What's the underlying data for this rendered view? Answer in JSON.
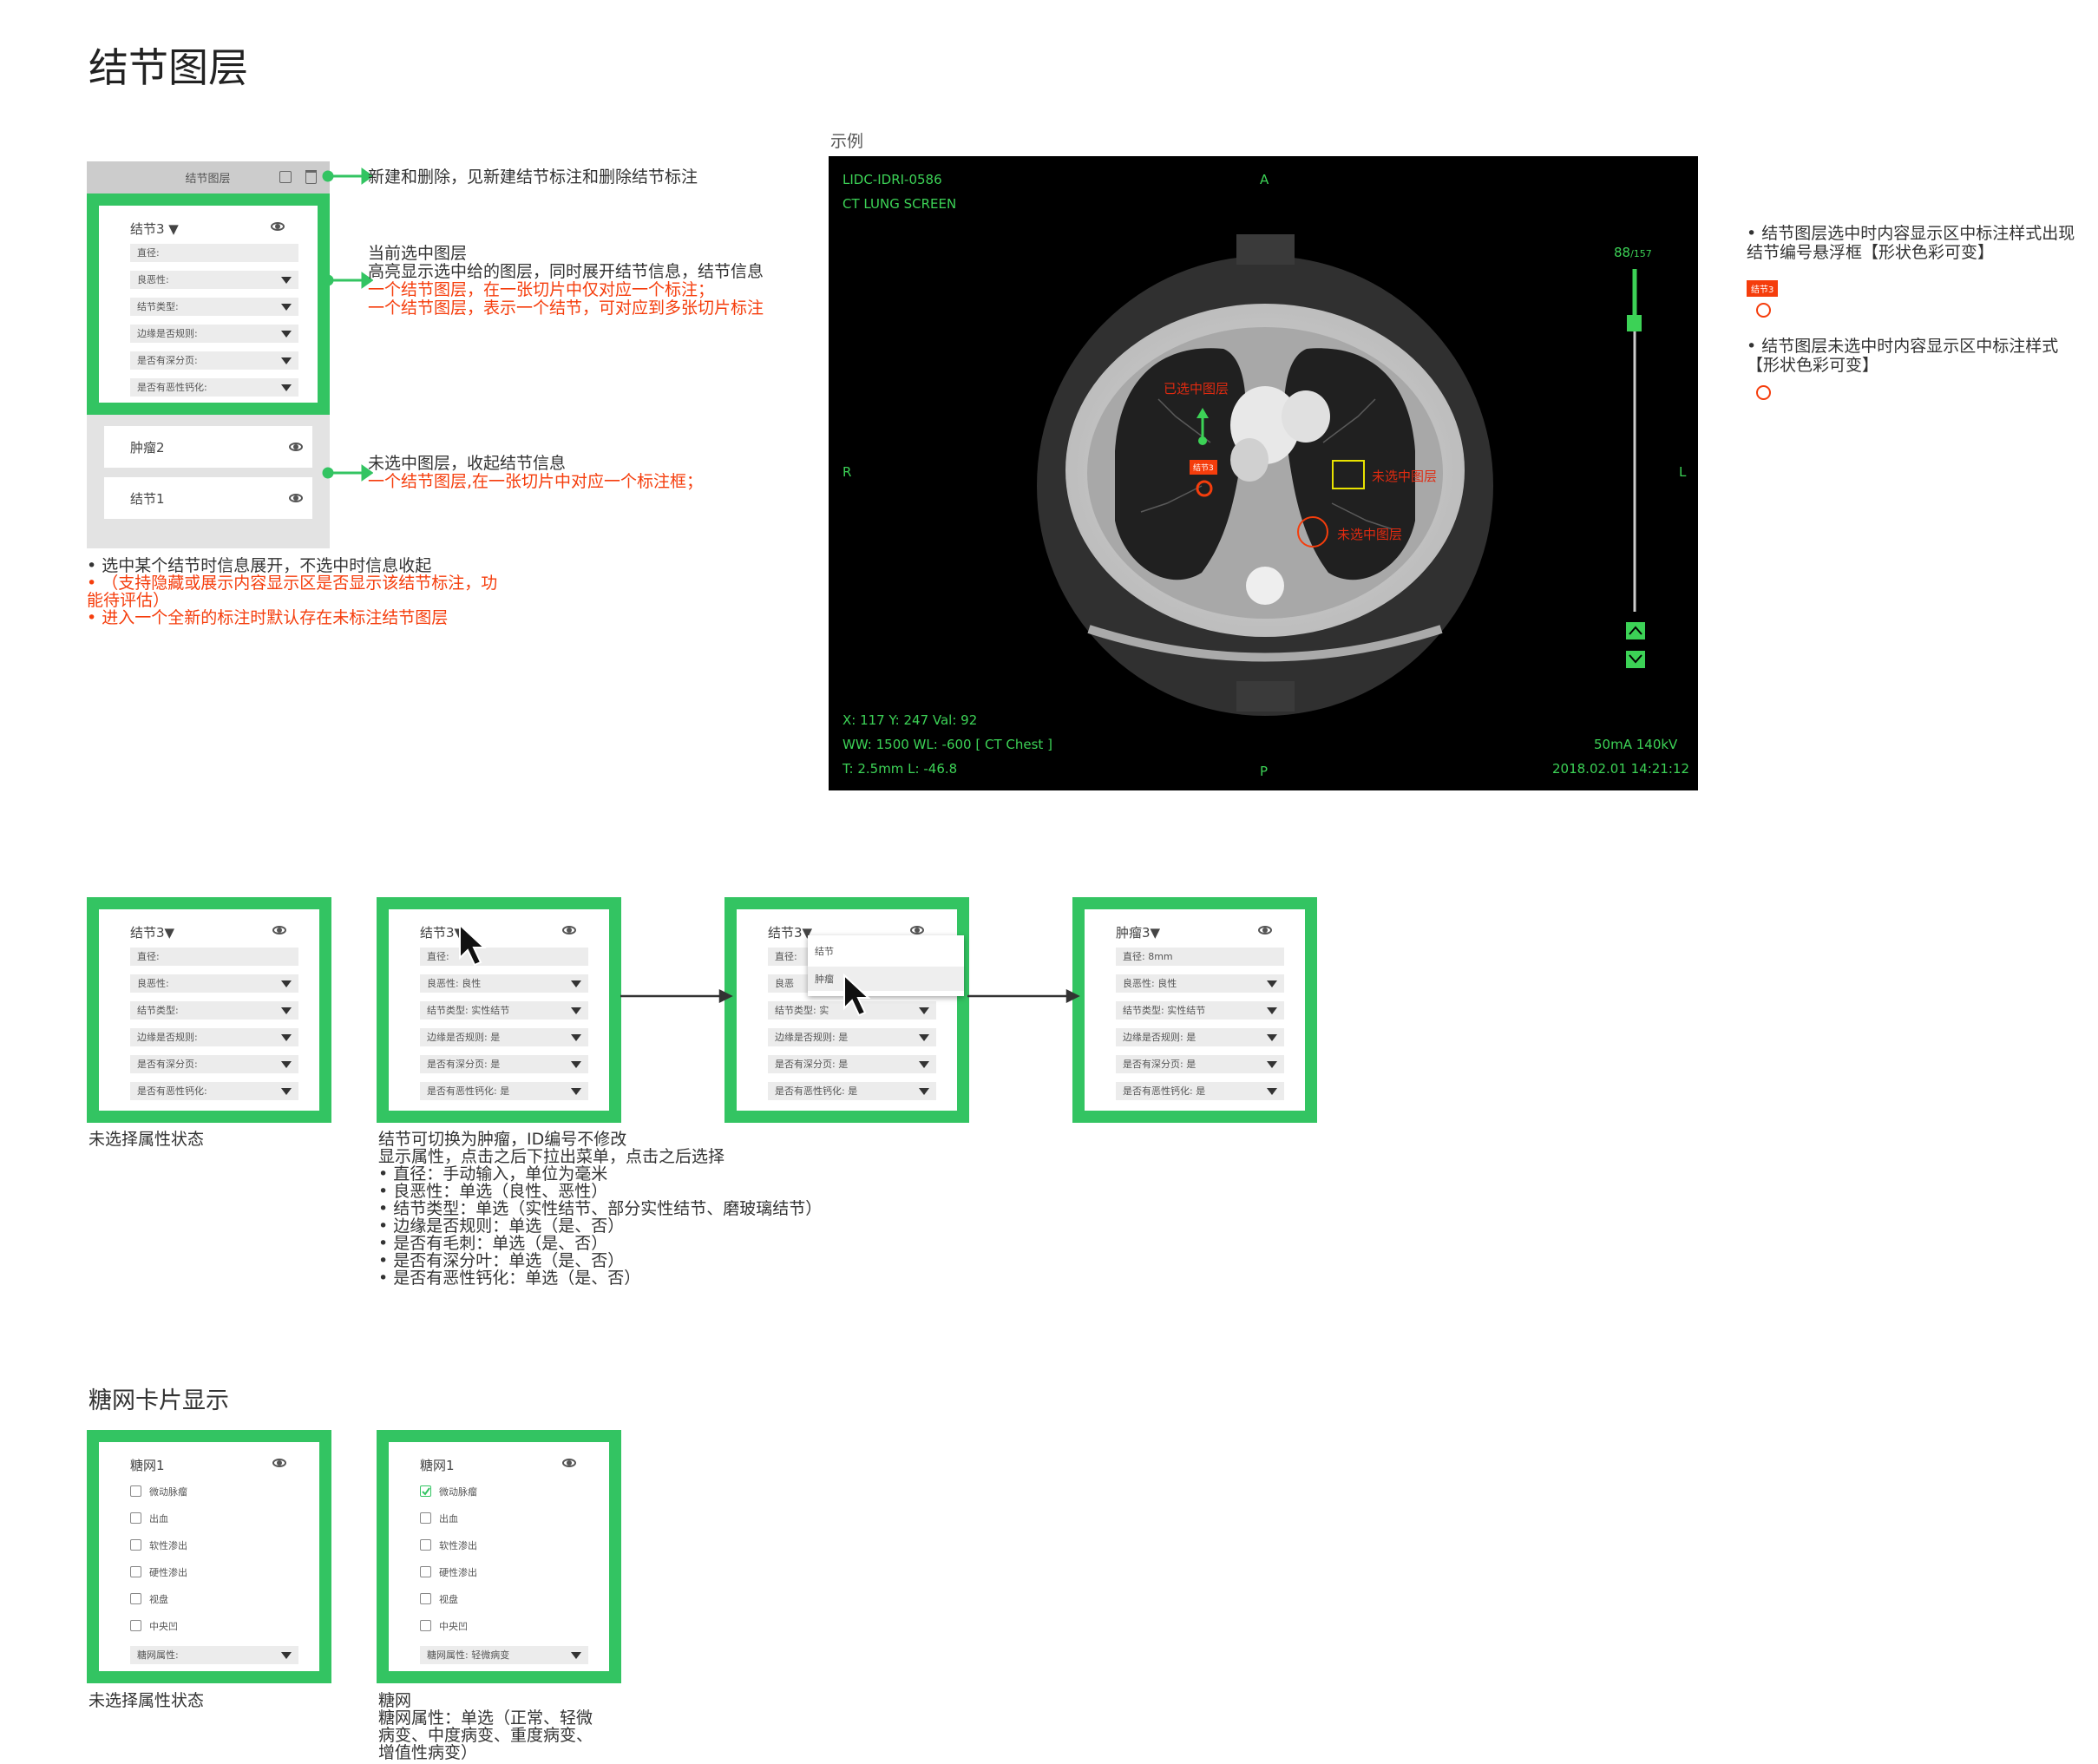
{
  "page_title": "结节图层",
  "example_label": "示例",
  "layer_panel": {
    "header": "结节图层",
    "selected": {
      "name": "结节3 ▼",
      "fields": [
        "直径:",
        "良恶性:",
        "结节类型:",
        "边缘是否规则:",
        "是否有深分页:",
        "是否有恶性钙化:"
      ]
    },
    "collapsed": [
      {
        "name": "肿瘤2"
      },
      {
        "name": "结节1"
      }
    ]
  },
  "annotations": {
    "a1": "新建和删除，见新建结节标注和删除结节标注",
    "a2_lines": [
      "当前选中图层",
      "高亮显示选中给的图层，同时展开结节信息，结节信息"
    ],
    "a2_red": [
      "一个结节图层，在一张切片中仅对应一个标注；",
      "一个结节图层，表示一个结节，可对应到多张切片标注"
    ],
    "a3": "未选中图层，收起结节信息",
    "a3_red": "一个结节图层,在一张切片中对应一个标注框；"
  },
  "notes1": {
    "l1": "• 选中某个结节时信息展开，不选中时信息收起",
    "l2": "• （支持隐藏或展示内容显示区是否显示该结节标注，功",
    "l3": "能待评估）",
    "l4": "• 进入一个全新的标注时默认存在未标注结节图层"
  },
  "ct": {
    "patient": "LIDC-IDRI-0586",
    "study": "CT   LUNG   SCREEN",
    "dir_a": "A",
    "dir_p": "P",
    "dir_r": "R",
    "dir_l": "L",
    "slice": "88",
    "slice_total": "/157",
    "coords": "X: 117    Y: 247    Val: 92",
    "window": "WW: 1500    WL: -600 [ CT Chest ]",
    "thick": "T: 2.5mm    L: -46.8",
    "tube": "50mA    140kV",
    "datetime": "2018.02.01    14:21:12",
    "lbl_selected": "已选中图层",
    "lbl_unselected1": "未选中图层",
    "lbl_unselected2": "未选中图层",
    "tag": "结节3"
  },
  "right_notes": {
    "n1a": "• 结节图层选中时内容显示区中标注样式出现",
    "n1b": "结节编号悬浮框【形状色彩可变】",
    "tag": "结节3",
    "n2a": "• 结节图层未选中时内容显示区中标注样式",
    "n2b": "【形状色彩可变】"
  },
  "flow": {
    "c1": {
      "name": "结节3▼",
      "fields": [
        "直径:",
        "良恶性:",
        "结节类型:",
        "边缘是否规则:",
        "是否有深分页:",
        "是否有恶性钙化:"
      ]
    },
    "c2": {
      "name": "结节3▼",
      "fields": [
        "直径:",
        "良恶性:  良性",
        "结节类型:  实性结节",
        "边缘是否规则:  是",
        "是否有深分页:  是",
        "是否有恶性钙化:  是"
      ]
    },
    "c3": {
      "name": "结节3▼",
      "fields": [
        "直径:",
        "良恶",
        "结节类型:  实",
        "边缘是否规则:  是",
        "是否有深分页:  是",
        "是否有恶性钙化:  是"
      ],
      "menu": [
        "结节",
        "肿瘤"
      ]
    },
    "c4": {
      "name": "肿瘤3▼",
      "fields": [
        "直径:  8mm",
        "良恶性:  良性",
        "结节类型:  实性结节",
        "边缘是否规则:  是",
        "是否有深分页:  是",
        "是否有恶性钙化:  是"
      ]
    },
    "cap1": "未选择属性状态",
    "cap2": [
      "结节可切换为肿瘤，ID编号不修改",
      "显示属性，点击之后下拉出菜单，点击之后选择",
      "• 直径：手动输入，单位为毫米",
      "• 良恶性：单选（良性、恶性）",
      "• 结节类型：单选（实性结节、部分实性结节、磨玻璃结节）",
      "• 边缘是否规则：单选（是、否）",
      "• 是否有毛刺：单选（是、否）",
      "• 是否有深分叶：单选（是、否）",
      "• 是否有恶性钙化：单选（是、否）"
    ]
  },
  "dr": {
    "heading": "糖网卡片显示",
    "c1": {
      "name": "糖网1",
      "items": [
        "微动脉瘤",
        "出血",
        "软性渗出",
        "硬性渗出",
        "视盘",
        "中央凹"
      ],
      "select": "糖网属性:"
    },
    "c2": {
      "name": "糖网1",
      "items": [
        "微动脉瘤",
        "出血",
        "软性渗出",
        "硬性渗出",
        "视盘",
        "中央凹"
      ],
      "select": "糖网属性:  轻微病变"
    },
    "cap1": "未选择属性状态",
    "cap2": [
      "糖网",
      "糖网属性：单选（正常、轻微",
      "病变、中度病变、重度病变、",
      "增值性病变）"
    ]
  },
  "colors": {
    "green": "#33c462",
    "red": "#f53d0c",
    "ct_text": "#3cd256"
  }
}
